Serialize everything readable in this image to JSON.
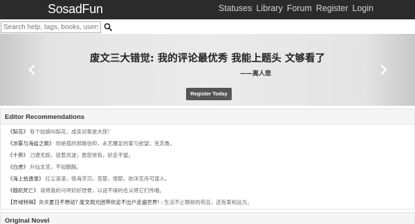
{
  "header": {
    "brand": "SosadFun",
    "nav": [
      "Statuses",
      "Library",
      "Forum",
      "Register",
      "Login"
    ]
  },
  "search": {
    "placeholder": "Search help, tags, books, users...",
    "icon": "search-icon"
  },
  "carousel": {
    "quote": "废文三大错觉: 我的评论最优秀 我能上题头 文够看了",
    "author": "——离人悲",
    "register_label": "Register Today",
    "prev_icon": "chevron-left-icon",
    "next_icon": "chevron-right-icon"
  },
  "editor_recommendations": {
    "heading": "Editor Recommendations",
    "items": [
      {
        "title": "《梨花》",
        "desc": "有个姑娘叫梨花，成亲对象是大侠!"
      },
      {
        "title": "《浓雾与海盐之歌》",
        "desc": "你是孤的邪路信仰，永无餍足的爱与欲望，克苏鲁。"
      },
      {
        "title": "《十奔》",
        "desc": "刀谱无踪，徒惹风波；恩怨常有，好走不留。"
      },
      {
        "title": "《白虎》",
        "desc": "升仙太苦，不如胭脂。"
      },
      {
        "title": "《海上拾遗录》",
        "desc": "红尘滚滚，情海浮沉，苦耶，恨耶，欲洋无舟可渡人。"
      },
      {
        "title": "《随机死亡》",
        "desc": "请将我的马甲好好捏脊，以说不得的名义将它们传唱。"
      },
      {
        "title": "【异域特辑】炎炎夏日不想动? 废文观光团带你足不出户走遍世界! :",
        "desc": "生活不止眼前的苟且，还有爱和远方。"
      }
    ]
  },
  "original_novel": {
    "heading": "Original Novel"
  },
  "colors": {
    "navbar_bg": "#2b2b2b",
    "button_bg": "#555555",
    "panel_heading_bg": "#f5f5f5"
  }
}
